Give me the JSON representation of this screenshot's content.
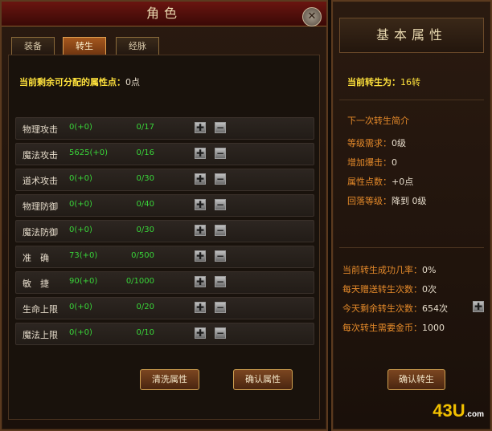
{
  "left_panel": {
    "title": "角色",
    "close_glyph": "✕",
    "tabs": [
      "装备",
      "转生",
      "经脉"
    ],
    "active_tab": 1,
    "points_label": "当前剩余可分配的属性点：",
    "points_value": "0点",
    "attributes": [
      {
        "name": "物理攻击",
        "value": "0(+0)",
        "current": "0/17"
      },
      {
        "name": "魔法攻击",
        "value": "5625(+0)",
        "current": "0/16"
      },
      {
        "name": "道术攻击",
        "value": "0(+0)",
        "current": "0/30"
      },
      {
        "name": "物理防御",
        "value": "0(+0)",
        "current": "0/40"
      },
      {
        "name": "魔法防御",
        "value": "0(+0)",
        "current": "0/30"
      },
      {
        "name": "准　确",
        "value": "73(+0)",
        "current": "0/500"
      },
      {
        "name": "敏　捷",
        "value": "90(+0)",
        "current": "0/1000"
      },
      {
        "name": "生命上限",
        "value": "0(+0)",
        "current": "0/20"
      },
      {
        "name": "魔法上限",
        "value": "0(+0)",
        "current": "0/10"
      }
    ],
    "plus_glyph": "✚",
    "minus_glyph": "−",
    "reset_button": "清洗属性",
    "confirm_button": "确认属性"
  },
  "right_panel": {
    "title": "基本属性",
    "current_rebirth_label": "当前转生为：",
    "current_rebirth_value": "16转",
    "next_intro": "下一次转生简介",
    "level_req_label": "等级需求：",
    "level_req_value": "0级",
    "crit_label": "增加爆击：",
    "crit_value": "0",
    "points_label": "属性点数：",
    "points_value": "+0点",
    "drop_label": "回落等级：",
    "drop_value": "降到 0级",
    "success_label": "当前转生成功几率：",
    "success_value": "0%",
    "daily_gift_label": "每天赠送转生次数：",
    "daily_gift_value": "0次",
    "remaining_label": "今天剩余转生次数：",
    "remaining_value": "654次",
    "gold_label": "每次转生需要金币：",
    "gold_value": "1000",
    "confirm_button": "确认转生",
    "logo": "43U",
    "logo_suffix": ".com"
  },
  "colors": {
    "accent_yellow": "#ffe23c",
    "value_green": "#39d439",
    "label_orange": "#e58a2a"
  }
}
